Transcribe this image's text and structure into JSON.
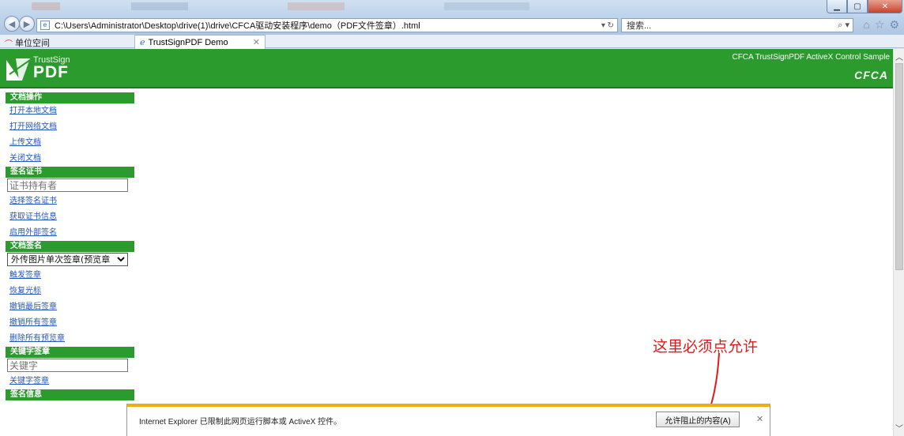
{
  "browser": {
    "address": "C:\\Users\\Administrator\\Desktop\\drive(1)\\drive\\CFCA驱动安装程序\\demo（PDF文件签章）.html",
    "search_placeholder": "搜索...",
    "favorite_label": "单位空间",
    "tab_title": "TrustSignPDF Demo"
  },
  "header": {
    "logo_line1": "TrustSign",
    "logo_line2": "PDF",
    "title": "CFCA TrustSignPDF ActiveX Control Sample",
    "brand": "CFCA"
  },
  "sidebar": {
    "doc_ops": {
      "title": "文档操作",
      "items": [
        "打开本地文档",
        "打开网络文档",
        "上传文档",
        "关闭文档"
      ]
    },
    "cert": {
      "title": "签名证书",
      "holder_placeholder": "证书持有者",
      "items": [
        "选择签名证书",
        "获取证书信息",
        "启用外部签名"
      ]
    },
    "sign": {
      "title": "文档签名",
      "select_value": "外传图片单次签章(预览章",
      "items": [
        "触发签章",
        "恢复光标",
        "撤销最后签章",
        "撤销所有签章",
        "删除所有预览章"
      ]
    },
    "keyword": {
      "title": "关键字签章",
      "input_placeholder": "关键字",
      "items": [
        "关键字签章"
      ]
    },
    "info": {
      "title": "签名信息"
    }
  },
  "annotation": {
    "text": "这里必须点允许",
    "color": "#e01b1b"
  },
  "infobar": {
    "message": "Internet Explorer 已限制此网页运行脚本或 ActiveX 控件。",
    "allow_label": "允许阻止的内容(A)"
  },
  "colors": {
    "header_green": "#2b9b2e",
    "link_blue": "#2557b8",
    "infobar_accent": "#e7b20f"
  }
}
